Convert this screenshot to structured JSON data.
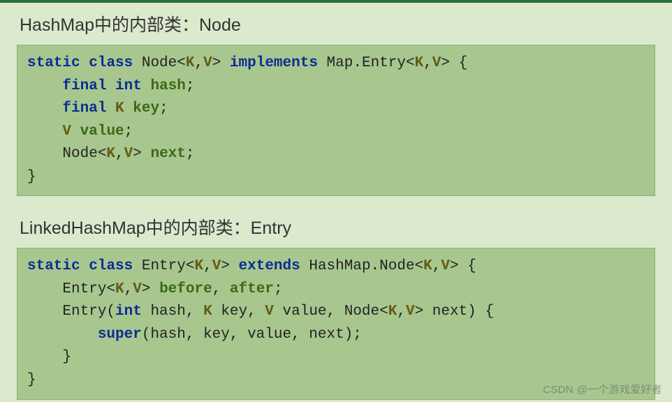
{
  "section1": {
    "heading": "HashMap中的内部类：Node",
    "code": {
      "l1a": "static",
      "l1b": " ",
      "l1c": "class",
      "l1d": " Node<",
      "l1e": "K",
      "l1f": ",",
      "l1g": "V",
      "l1h": "> ",
      "l1i": "implements",
      "l1j": " Map.Entry<",
      "l1k": "K",
      "l1l": ",",
      "l1m": "V",
      "l1n": "> {",
      "l2a": "    ",
      "l2b": "final",
      "l2c": " ",
      "l2d": "int",
      "l2e": " ",
      "l2f": "hash",
      "l2g": ";",
      "l3a": "    ",
      "l3b": "final",
      "l3c": " ",
      "l3d": "K",
      "l3e": " ",
      "l3f": "key",
      "l3g": ";",
      "l4a": "    ",
      "l4b": "V",
      "l4c": " ",
      "l4d": "value",
      "l4e": ";",
      "l5a": "    Node<",
      "l5b": "K",
      "l5c": ",",
      "l5d": "V",
      "l5e": "> ",
      "l5f": "next",
      "l5g": ";",
      "l6": "}"
    }
  },
  "section2": {
    "heading": "LinkedHashMap中的内部类：Entry",
    "code": {
      "l1a": "static",
      "l1b": " ",
      "l1c": "class",
      "l1d": " Entry<",
      "l1e": "K",
      "l1f": ",",
      "l1g": "V",
      "l1h": "> ",
      "l1i": "extends",
      "l1j": " HashMap.Node<",
      "l1k": "K",
      "l1l": ",",
      "l1m": "V",
      "l1n": "> {",
      "l2a": "    Entry<",
      "l2b": "K",
      "l2c": ",",
      "l2d": "V",
      "l2e": "> ",
      "l2f": "before",
      "l2g": ", ",
      "l2h": "after",
      "l2i": ";",
      "l3a": "    Entry(",
      "l3b": "int",
      "l3c": " hash, ",
      "l3d": "K",
      "l3e": " key, ",
      "l3f": "V",
      "l3g": " value, Node<",
      "l3h": "K",
      "l3i": ",",
      "l3j": "V",
      "l3k": "> next) {",
      "l4a": "        ",
      "l4b": "super",
      "l4c": "(hash, key, value, next);",
      "l5": "    }",
      "l6": "}"
    }
  },
  "watermark": "CSDN @一个游戏爱好者"
}
